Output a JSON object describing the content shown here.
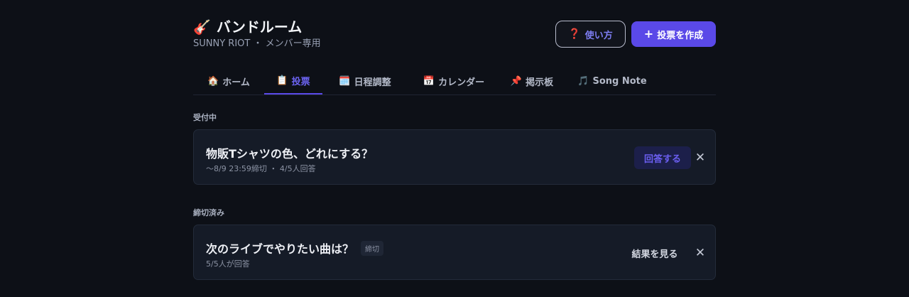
{
  "header": {
    "icon": "🎸",
    "title": "バンドルーム",
    "subtitle": "SUNNY RIOT ・ メンバー専用",
    "help_icon": "❓",
    "help_label": "使い方",
    "create_icon": "+",
    "create_label": "投票を作成"
  },
  "tabs": [
    {
      "icon": "🏠",
      "label": "ホーム",
      "active": false
    },
    {
      "icon": "📋",
      "label": "投票",
      "active": true
    },
    {
      "icon": "🗓️",
      "label": "日程調整",
      "active": false
    },
    {
      "icon": "📅",
      "label": "カレンダー",
      "active": false
    },
    {
      "icon": "📌",
      "label": "掲示板",
      "active": false
    },
    {
      "icon": "🎵",
      "label": "Song Note",
      "active": false
    }
  ],
  "sections": {
    "open": {
      "label": "受付中",
      "poll": {
        "title": "物販Tシャツの色、どれにする？",
        "meta": "〜8/9 23:59締切 ・ 4/5人回答",
        "action": "回答する",
        "close_icon": "✕"
      }
    },
    "closed": {
      "label": "締切済み",
      "poll": {
        "title": "次のライブでやりたい曲は？",
        "badge": "締切",
        "meta": "5/5人が回答",
        "action": "結果を見る",
        "close_icon": "✕"
      }
    }
  }
}
